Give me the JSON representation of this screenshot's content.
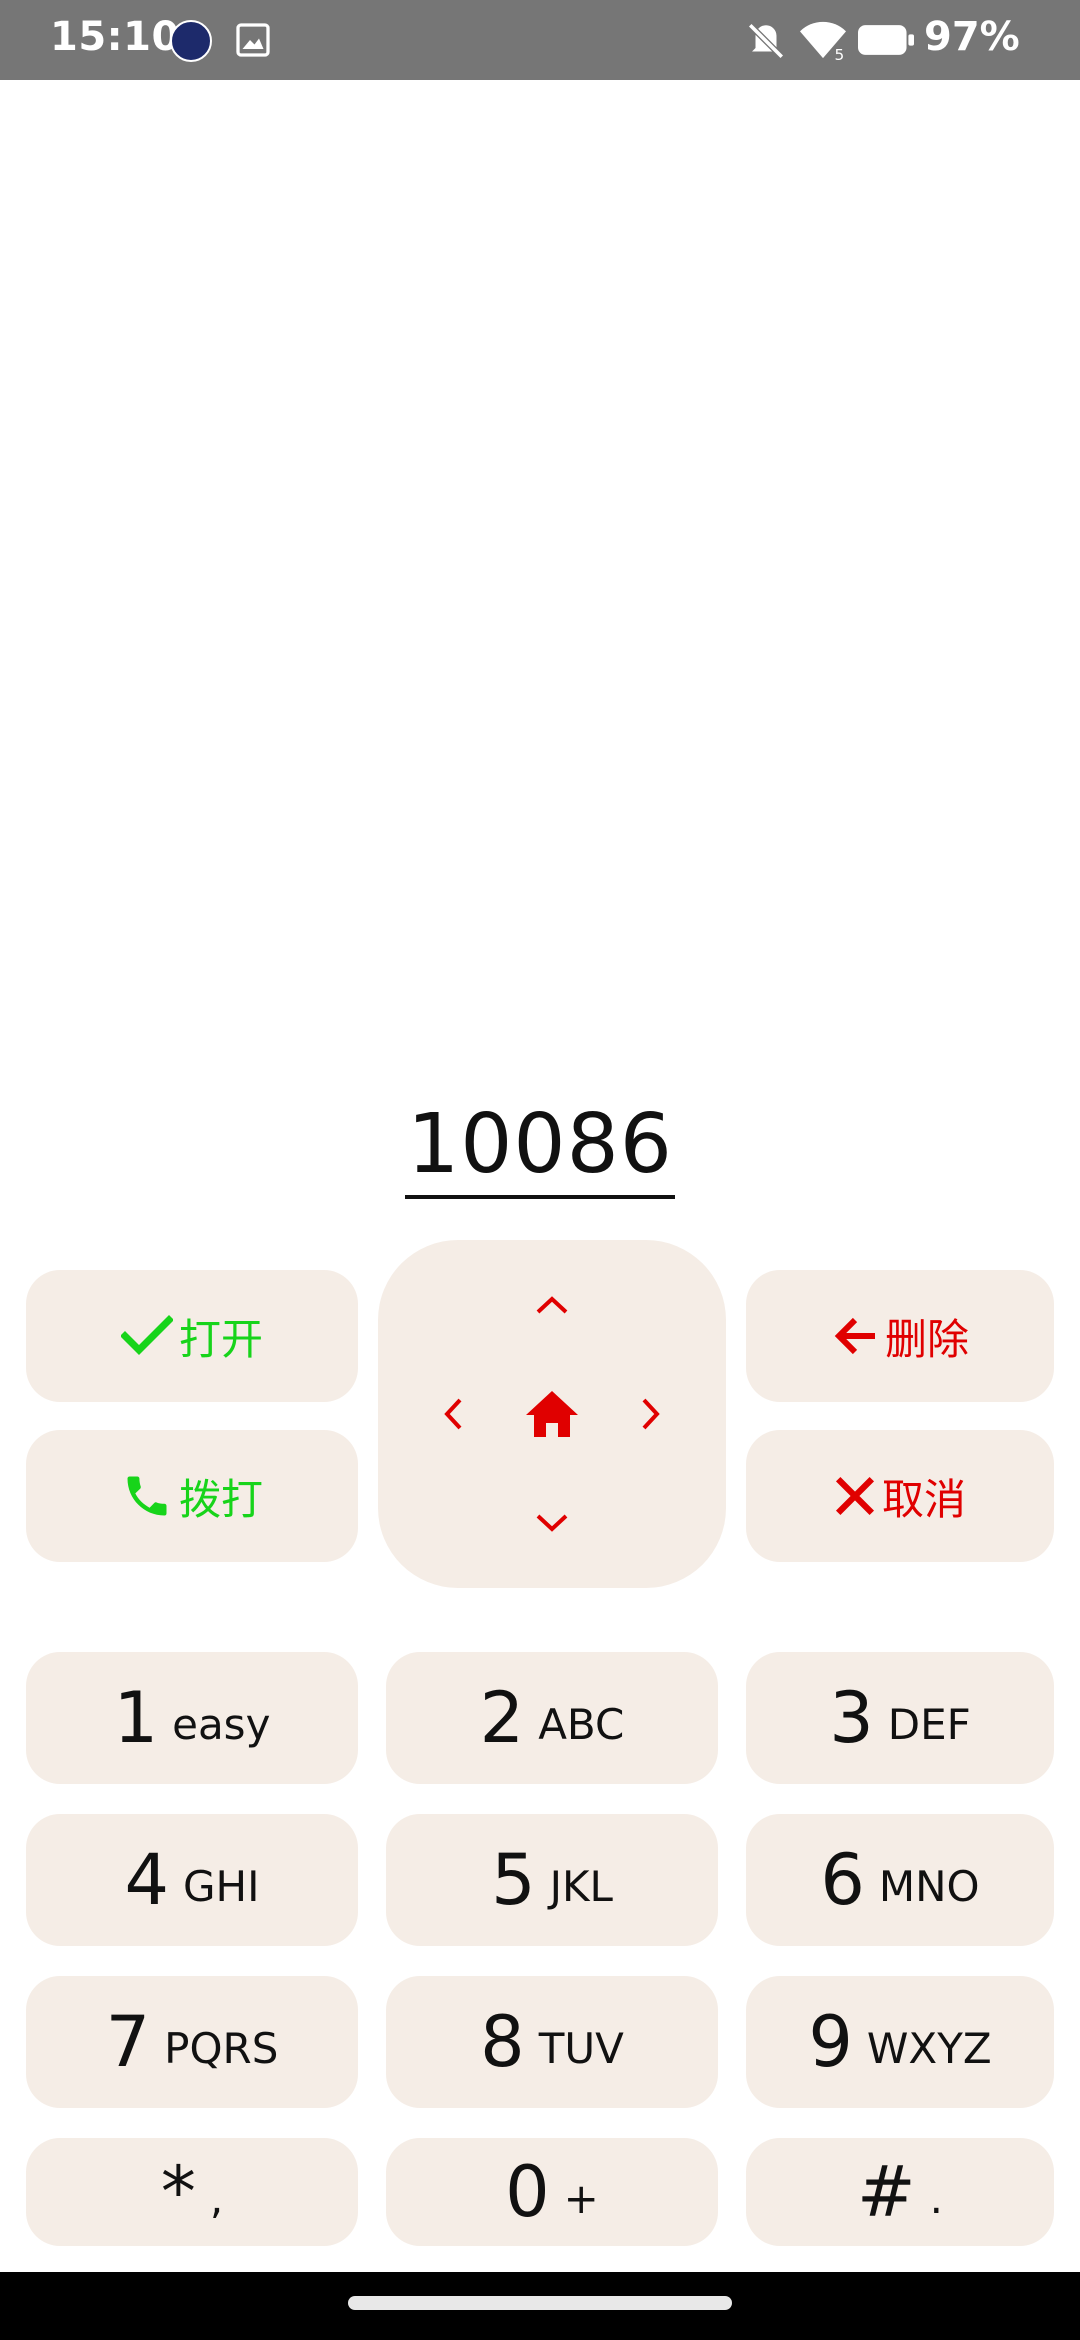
{
  "status_bar": {
    "time": "15:10",
    "battery_percent": "97%",
    "wifi_badge": "5",
    "icons": [
      "app-badge-icon",
      "gallery-icon",
      "mute-icon",
      "wifi-icon",
      "battery-icon"
    ]
  },
  "display": {
    "number": "10086"
  },
  "actions": {
    "open": {
      "label": "打开",
      "icon": "check-icon"
    },
    "dial": {
      "label": "拨打",
      "icon": "phone-icon"
    },
    "delete": {
      "label": "删除",
      "icon": "arrow-left-icon"
    },
    "cancel": {
      "label": "取消",
      "icon": "close-icon"
    }
  },
  "dpad": {
    "icons": [
      "chevron-up-icon",
      "chevron-left-icon",
      "home-icon",
      "chevron-right-icon",
      "chevron-down-icon"
    ]
  },
  "keypad": [
    {
      "digit": "1",
      "letters": "easy"
    },
    {
      "digit": "2",
      "letters": "ABC"
    },
    {
      "digit": "3",
      "letters": "DEF"
    },
    {
      "digit": "4",
      "letters": "GHI"
    },
    {
      "digit": "5",
      "letters": "JKL"
    },
    {
      "digit": "6",
      "letters": "MNO"
    },
    {
      "digit": "7",
      "letters": "PQRS"
    },
    {
      "digit": "8",
      "letters": "TUV"
    },
    {
      "digit": "9",
      "letters": "WXYZ"
    },
    {
      "digit": "*",
      "letters": ","
    },
    {
      "digit": "0",
      "letters": "+"
    },
    {
      "digit": "#",
      "letters": "."
    }
  ],
  "colors": {
    "accent_red": "#e00000",
    "accent_green": "#17d41a",
    "key_bg": "#f5ede6",
    "status_bg": "#767676"
  }
}
